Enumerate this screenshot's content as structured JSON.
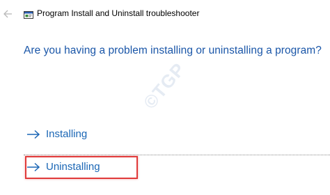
{
  "window": {
    "title": "Program Install and Uninstall troubleshooter"
  },
  "main": {
    "question": "Are you having a problem installing or uninstalling a program?",
    "options": [
      {
        "label": "Installing",
        "icon": "right-arrow-icon"
      },
      {
        "label": "Uninstalling",
        "icon": "right-arrow-icon",
        "highlighted": true
      }
    ]
  },
  "watermark": {
    "text": "©TGP"
  },
  "colors": {
    "accent": "#1a66b5",
    "question": "#1a56a8",
    "highlight": "#e03a3a",
    "back_arrow": "#b8b8b8"
  }
}
